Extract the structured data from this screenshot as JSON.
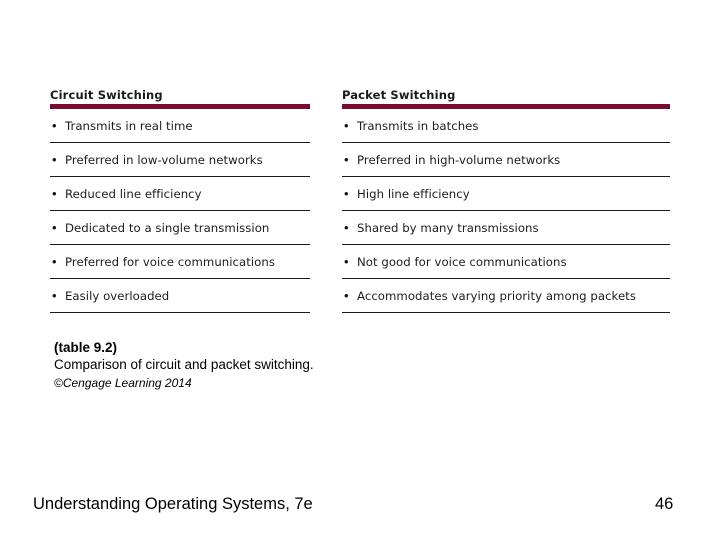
{
  "theme": {
    "accent_color": "#7c0c2e",
    "rule_color": "#1a1a1a",
    "text_color": "#000000",
    "background": "#ffffff"
  },
  "table": {
    "columns": [
      {
        "header": "Circuit Switching",
        "rows": [
          "Transmits in real time",
          "Preferred in low-volume networks",
          "Reduced line efficiency",
          "Dedicated to a single transmission",
          "Preferred for voice communications",
          "Easily overloaded"
        ]
      },
      {
        "header": "Packet Switching",
        "rows": [
          "Transmits in batches",
          "Preferred in high-volume networks",
          "High line efficiency",
          "Shared by many transmissions",
          "Not good for voice communications",
          "Accommodates varying priority among packets"
        ]
      }
    ],
    "bullet_glyph": "•"
  },
  "caption": {
    "number": "(table 9.2)",
    "description": "Comparison of circuit and packet switching.",
    "copyright": "©Cengage Learning 2014"
  },
  "footer": {
    "title": "Understanding Operating Systems, 7e",
    "page_number": "46"
  }
}
